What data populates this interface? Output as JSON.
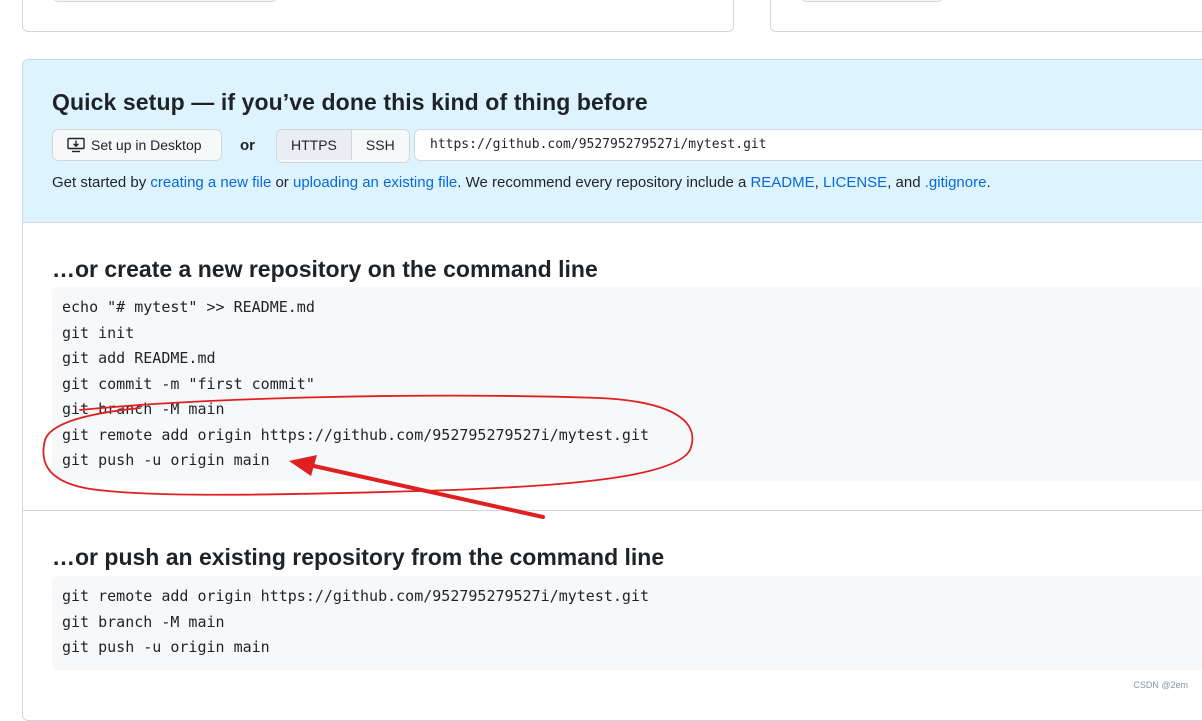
{
  "quick_setup": {
    "title": "Quick setup — if you’ve done this kind of thing before",
    "desktop_button": "Set up in Desktop",
    "or_label": "or",
    "protocols": [
      "HTTPS",
      "SSH"
    ],
    "selected_protocol": "HTTPS",
    "clone_url": "https://github.com/952795279527i/mytest.git",
    "get_started": {
      "prefix": "Get started by ",
      "link_new_file": "creating a new file",
      "mid1": " or ",
      "link_upload": "uploading an existing file",
      "mid2": ". We recommend every repository include a ",
      "link_readme": "README",
      "sep1": ", ",
      "link_license": "LICENSE",
      "sep2": ", and ",
      "link_gitignore": ".gitignore",
      "suffix": "."
    }
  },
  "create_repo": {
    "title": "…or create a new repository on the command line",
    "lines": [
      "echo \"# mytest\" >> README.md",
      "git init",
      "git add README.md",
      "git commit -m \"first commit\"",
      "git branch -M main",
      "git remote add origin https://github.com/952795279527i/mytest.git",
      "git push -u origin main"
    ]
  },
  "push_existing": {
    "title": "…or push an existing repository from the command line",
    "lines": [
      "git remote add origin https://github.com/952795279527i/mytest.git",
      "git branch -M main",
      "git push -u origin main"
    ]
  },
  "annotation_color": "#e02020",
  "watermark": "CSDN @2em",
  "colors": {
    "link": "#0969da",
    "quick_bg": "#ddf4ff",
    "code_bg": "#f6f8fa"
  }
}
